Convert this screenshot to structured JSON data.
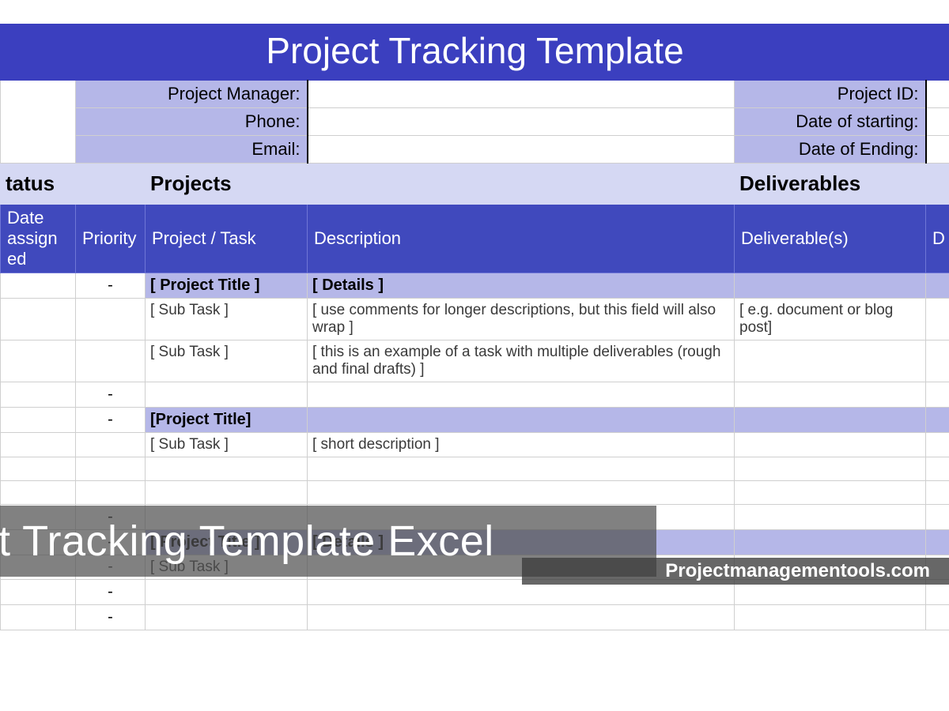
{
  "title": "Project Tracking Template",
  "meta": {
    "left": {
      "project_manager": "Project Manager:",
      "phone": "Phone:",
      "email": "Email:"
    },
    "right": {
      "project_id": "Project ID:",
      "date_start": "Date of starting:",
      "date_end": "Date of Ending:"
    }
  },
  "group_headers": {
    "status": "tatus",
    "projects": "Projects",
    "deliverables": "Deliverables"
  },
  "column_headers": {
    "date_assigned": "Date assign ed",
    "priority": "Priority",
    "project_task": "Project / Task",
    "description": "Description",
    "deliverables": "Deliverable(s)",
    "d_cut": "D"
  },
  "rows": [
    {
      "type": "project",
      "priority": "-",
      "task": "[ Project Title ]",
      "desc": "[ Details ]",
      "deliv": ""
    },
    {
      "type": "task",
      "priority": "",
      "task": "[ Sub Task ]",
      "desc": "[ use comments for longer descriptions, but this field will also wrap ]",
      "deliv": "[ e.g. document or blog post]"
    },
    {
      "type": "task",
      "priority": "",
      "task": "[ Sub Task ]",
      "desc": "[ this is an example of a task with multiple deliverables (rough and final drafts) ]",
      "deliv": ""
    },
    {
      "type": "sep",
      "priority": "-",
      "task": "",
      "desc": "",
      "deliv": ""
    },
    {
      "type": "project",
      "priority": "-",
      "task": "[Project Title]",
      "desc": "",
      "deliv": ""
    },
    {
      "type": "task",
      "priority": "",
      "task": "[ Sub Task ]",
      "desc": "[ short description ]",
      "deliv": ""
    },
    {
      "type": "task",
      "priority": "",
      "task": "",
      "desc": "",
      "deliv": ""
    },
    {
      "type": "task",
      "priority": "",
      "task": "",
      "desc": "",
      "deliv": ""
    },
    {
      "type": "sep",
      "priority": "-",
      "task": "",
      "desc": "",
      "deliv": ""
    },
    {
      "type": "project",
      "priority": "-",
      "task": "[ Project Title ]",
      "desc": "[ Details ]",
      "deliv": ""
    },
    {
      "type": "task",
      "priority": "-",
      "task": "[ Sub Task ]",
      "desc": "",
      "deliv": ""
    },
    {
      "type": "sep",
      "priority": "-",
      "task": "",
      "desc": "",
      "deliv": ""
    },
    {
      "type": "sep",
      "priority": "-",
      "task": "",
      "desc": "",
      "deliv": ""
    }
  ],
  "watermark": {
    "big": "ect Tracking Template Excel",
    "small": "Projectmanagementools.com"
  }
}
